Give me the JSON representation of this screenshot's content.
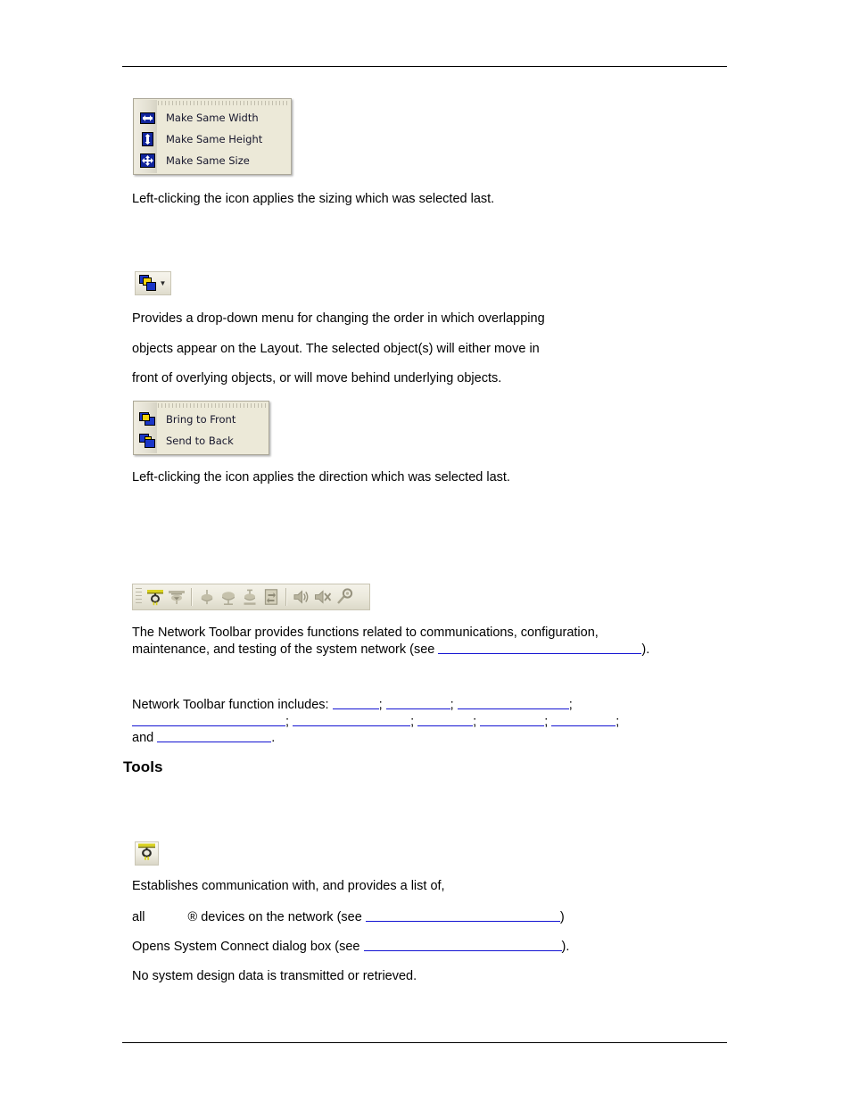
{
  "document": {
    "header_rule": true,
    "footer_rule": true
  },
  "sizing_menu": {
    "name": "sizing-dropdown-menu",
    "items": [
      {
        "label": "Make Same Width",
        "icon": "make-same-width-icon"
      },
      {
        "label": "Make Same Height",
        "icon": "make-same-height-icon"
      },
      {
        "label": "Make Same Size",
        "icon": "make-same-size-icon"
      }
    ]
  },
  "sizing_caption": "Left-clicking the icon applies the sizing which was selected last.",
  "order_button": {
    "icon": "bring-to-front-icon",
    "dropdown_arrow": "▼"
  },
  "order_description": {
    "line1": "Provides a drop-down menu for changing the order in which overlapping",
    "line2": "objects appear on the Layout. The selected object(s) will either move in",
    "line3": "front of overlying objects, or will move behind underlying objects."
  },
  "order_menu": {
    "name": "order-dropdown-menu",
    "items": [
      {
        "label": "Bring to Front",
        "icon": "bring-to-front-icon"
      },
      {
        "label": "Send to Back",
        "icon": "send-to-back-icon"
      }
    ]
  },
  "order_caption": "Left-clicking the icon applies the direction which was selected last.",
  "network_toolbar": {
    "name": "network-toolbar",
    "icons": [
      "system-connect-icon",
      "network-download-icon",
      "device-tree-icon",
      "device-group-icon",
      "network-upload-icon",
      "device-properties-icon",
      "audio-test-icon",
      "mute-test-icon",
      "diagnostics-icon"
    ],
    "separator_positions": [
      2,
      6
    ]
  },
  "network_description": {
    "line1": "The Network Toolbar provides functions related to communications, configuration,",
    "line2_before": "maintenance, and testing of the system network (see ",
    "line2_after": ")."
  },
  "network_functions": {
    "lead": "Network Toolbar function includes: ",
    "trailing_and": "and ",
    "semicolon": ";",
    "period": ".",
    "blank_widths_line1": [
      52,
      72,
      125
    ],
    "blank_widths_line2": [
      172,
      132,
      62,
      72,
      72
    ],
    "blank_widths_line3": [
      128
    ]
  },
  "tools_heading": "Tools",
  "tools": {
    "connect_icon": "system-connect-plug-icon",
    "line1": "Establishes communication with, and provides a list of,",
    "line2_pre": "all",
    "line2_mark": "®",
    "line2_mid": " devices on the network (see ",
    "line2_post": ")",
    "line3_pre": "Opens System Connect dialog box (see ",
    "line3_post": ").",
    "line4": "No system design data is transmitted or retrieved."
  }
}
